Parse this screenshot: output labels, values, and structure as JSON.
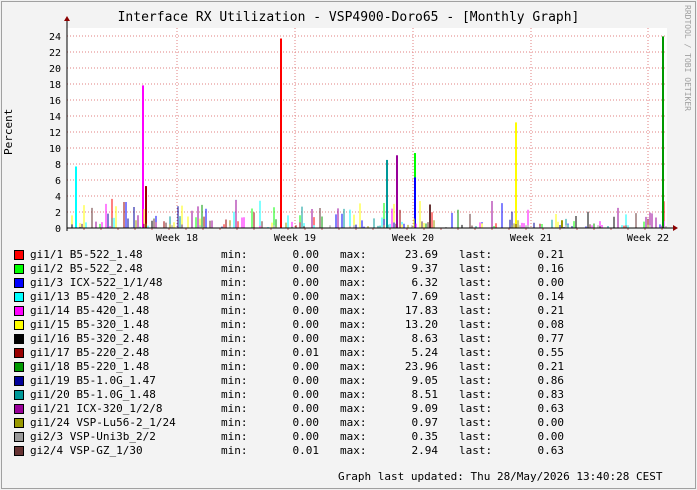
{
  "title": "Interface RX Utilization - VSP4900-Doro65 - [Monthly Graph]",
  "watermark": "RRDTOOL / TOBI OETIKER",
  "updated": "Graph last updated: Thu 28/May/2026 13:40:28 CEST",
  "stat_labels": {
    "min": "min:",
    "max": "max:",
    "last": "last:"
  },
  "chart_data": {
    "type": "bar",
    "ylabel": "Percent",
    "ylim": [
      0,
      25
    ],
    "yticks": [
      0,
      2,
      4,
      6,
      8,
      10,
      12,
      14,
      16,
      18,
      20,
      22,
      24
    ],
    "xticks": [
      "Week 18",
      "Week 19",
      "Week 20",
      "Week 21",
      "Week 22"
    ],
    "grid": true,
    "colors": {
      "background": "#f3f3f3",
      "plot": "#ffffff",
      "grid": "#e08080"
    },
    "series": [
      {
        "name": "gi1/1 B5-522_1.48",
        "color": "#ff0000",
        "min": "0.00",
        "max": "23.69",
        "last": "0.21"
      },
      {
        "name": "gi1/2 B5-522_2.48",
        "color": "#00ff00",
        "min": "0.00",
        "max": "9.37",
        "last": "0.16"
      },
      {
        "name": "gi1/3 ICX-522_1/1/48",
        "color": "#0000ff",
        "min": "0.00",
        "max": "6.32",
        "last": "0.00"
      },
      {
        "name": "gi1/13 B5-420_2.48",
        "color": "#00ffff",
        "min": "0.00",
        "max": "7.69",
        "last": "0.14"
      },
      {
        "name": "gi1/14 B5-420_1.48",
        "color": "#ff00ff",
        "min": "0.00",
        "max": "17.83",
        "last": "0.21"
      },
      {
        "name": "gi1/15 B5-320_1.48",
        "color": "#ffff00",
        "min": "0.00",
        "max": "13.20",
        "last": "0.08"
      },
      {
        "name": "gi1/16 B5-320_2.48",
        "color": "#000000",
        "min": "0.00",
        "max": "8.63",
        "last": "0.77"
      },
      {
        "name": "gi1/17 B5-220_2.48",
        "color": "#990000",
        "min": "0.01",
        "max": "5.24",
        "last": "0.55"
      },
      {
        "name": "gi1/18 B5-220_1.48",
        "color": "#009900",
        "min": "0.00",
        "max": "23.96",
        "last": "0.21"
      },
      {
        "name": "gi1/19 B5-1.0G_1.47",
        "color": "#000099",
        "min": "0.00",
        "max": "9.05",
        "last": "0.86"
      },
      {
        "name": "gi1/20 B5-1.0G_1.48",
        "color": "#009999",
        "min": "0.00",
        "max": "8.51",
        "last": "0.83"
      },
      {
        "name": "gi1/21 ICX-320_1/2/8",
        "color": "#990099",
        "min": "0.00",
        "max": "9.09",
        "last": "0.63"
      },
      {
        "name": "gi1/24 VSP-Lu56-2_1/24",
        "color": "#999900",
        "min": "0.00",
        "max": "0.97",
        "last": "0.00"
      },
      {
        "name": "gi2/3 VSP-Uni3b_2/2",
        "color": "#999999",
        "min": "0.00",
        "max": "0.35",
        "last": "0.00"
      },
      {
        "name": "gi2/4 VSP-GZ_1/30",
        "color": "#663333",
        "min": "0.01",
        "max": "2.94",
        "last": "0.63"
      }
    ]
  }
}
